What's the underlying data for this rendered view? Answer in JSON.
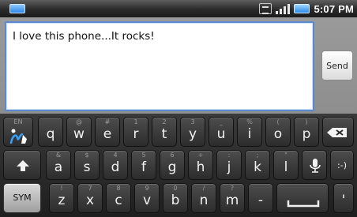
{
  "status_bar": {
    "time": "5:07 PM",
    "icons": [
      "usb-icon",
      "data-icon",
      "signal-icon",
      "battery-icon"
    ]
  },
  "compose": {
    "message_text": "I love this phone...It rocks!",
    "send_label": "Send"
  },
  "keyboard": {
    "row1": [
      {
        "main": "",
        "alt": "EN",
        "name": "input-method-key"
      },
      {
        "main": "q",
        "alt": "",
        "name": "key-q"
      },
      {
        "main": "w",
        "alt": "@",
        "name": "key-w"
      },
      {
        "main": "e",
        "alt": "#",
        "name": "key-e"
      },
      {
        "main": "r",
        "alt": "1",
        "name": "key-r"
      },
      {
        "main": "t",
        "alt": "2",
        "name": "key-t"
      },
      {
        "main": "y",
        "alt": "3",
        "name": "key-y"
      },
      {
        "main": "u",
        "alt": "_",
        "name": "key-u"
      },
      {
        "main": "i",
        "alt": "%",
        "name": "key-i"
      },
      {
        "main": "o",
        "alt": "(",
        "name": "key-o"
      },
      {
        "main": "p",
        "alt": ")",
        "name": "key-p"
      },
      {
        "main": "",
        "alt": "",
        "name": "delete-key"
      }
    ],
    "row2": [
      {
        "main": "",
        "alt": "",
        "name": "shift-key"
      },
      {
        "main": "a",
        "alt": "&",
        "name": "key-a"
      },
      {
        "main": "s",
        "alt": "$",
        "name": "key-s"
      },
      {
        "main": "d",
        "alt": "4",
        "name": "key-d"
      },
      {
        "main": "f",
        "alt": "5",
        "name": "key-f"
      },
      {
        "main": "g",
        "alt": "6",
        "name": "key-g"
      },
      {
        "main": "h",
        "alt": "+",
        "name": "key-h"
      },
      {
        "main": "j",
        "alt": ":",
        "name": "key-j"
      },
      {
        "main": "k",
        "alt": ";",
        "name": "key-k"
      },
      {
        "main": "l",
        "alt": "\"",
        "name": "key-l"
      },
      {
        "main": "",
        "alt": "",
        "name": "voice-input-key"
      },
      {
        "main": ":-)",
        "alt": "",
        "name": "smiley-key"
      }
    ],
    "row3": [
      {
        "main": "SYM",
        "alt": "",
        "name": "symbols-key"
      },
      {
        "main": "z",
        "alt": "!",
        "name": "key-z"
      },
      {
        "main": "x",
        "alt": "7",
        "name": "key-x"
      },
      {
        "main": "c",
        "alt": "8",
        "name": "key-c"
      },
      {
        "main": "v",
        "alt": "9",
        "name": "key-v"
      },
      {
        "main": "b",
        "alt": "0",
        "name": "key-b"
      },
      {
        "main": "n",
        "alt": "/",
        "name": "key-n"
      },
      {
        "main": "m",
        "alt": "?",
        "name": "key-m"
      },
      {
        "main": "-",
        "alt": "",
        "name": "key-hyphen"
      },
      {
        "main": "",
        "alt": "",
        "name": "space-key"
      },
      {
        "main": "'",
        "alt": "",
        "name": "key-apostrophe"
      }
    ]
  }
}
